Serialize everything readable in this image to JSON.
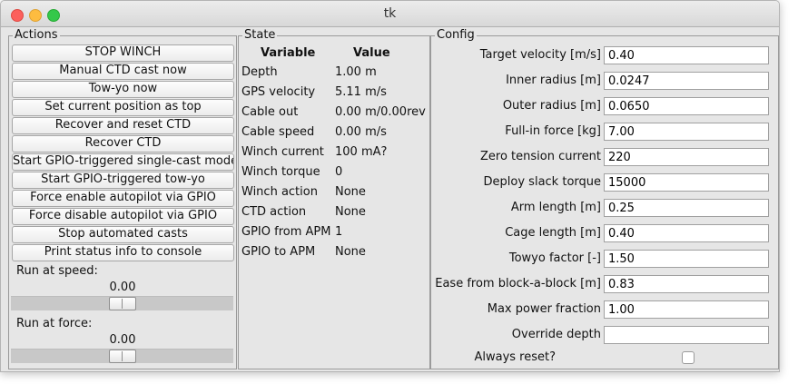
{
  "window": {
    "title": "tk"
  },
  "actions": {
    "title": "Actions",
    "buttons": [
      "STOP WINCH",
      "Manual CTD cast now",
      "Tow-yo now",
      "Set current position as top",
      "Recover and reset CTD",
      "Recover CTD",
      "Start GPIO-triggered single-cast mode",
      "Start GPIO-triggered tow-yo",
      "Force enable autopilot via GPIO",
      "Force disable autopilot via GPIO",
      "Stop automated casts",
      "Print status info to console"
    ],
    "speed": {
      "label": "Run at speed:",
      "value": "0.00",
      "level": 0.5
    },
    "force": {
      "label": "Run at force:",
      "value": "0.00",
      "level": 0.5
    }
  },
  "state": {
    "title": "State",
    "headers": {
      "variable": "Variable",
      "value": "Value"
    },
    "rows": [
      {
        "variable": "Depth",
        "value": "1.00 m"
      },
      {
        "variable": "GPS velocity",
        "value": "5.11 m/s"
      },
      {
        "variable": "Cable out",
        "value": "0.00 m/0.00rev"
      },
      {
        "variable": "Cable speed",
        "value": "0.00 m/s"
      },
      {
        "variable": "Winch current",
        "value": "100 mA?"
      },
      {
        "variable": "Winch torque",
        "value": "0"
      },
      {
        "variable": "Winch action",
        "value": "None"
      },
      {
        "variable": "CTD action",
        "value": "None"
      },
      {
        "variable": "GPIO from APM",
        "value": "1"
      },
      {
        "variable": "GPIO to APM",
        "value": "None"
      }
    ]
  },
  "config": {
    "title": "Config",
    "fields": [
      {
        "label": "Target velocity [m/s]",
        "value": "0.40"
      },
      {
        "label": "Inner radius [m]",
        "value": "0.0247"
      },
      {
        "label": "Outer radius [m]",
        "value": "0.0650"
      },
      {
        "label": "Full-in force [kg]",
        "value": "7.00"
      },
      {
        "label": "Zero tension current",
        "value": "220"
      },
      {
        "label": "Deploy slack torque",
        "value": "15000"
      },
      {
        "label": "Arm length [m]",
        "value": "0.25"
      },
      {
        "label": "Cage length [m]",
        "value": "0.40"
      },
      {
        "label": "Towyo factor [-]",
        "value": "1.50"
      },
      {
        "label": "Ease from block-a-block [m]",
        "value": "0.83"
      },
      {
        "label": "Max power fraction",
        "value": "1.00"
      },
      {
        "label": "Override depth",
        "value": ""
      }
    ],
    "always_reset": {
      "label": "Always reset?",
      "checked": false
    }
  }
}
